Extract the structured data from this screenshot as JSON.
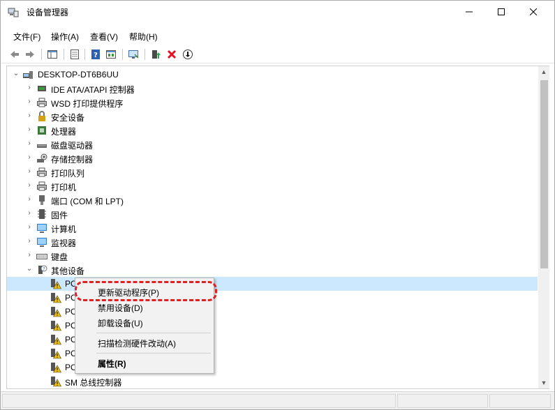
{
  "window": {
    "title": "设备管理器",
    "controls": {
      "minimize": "—",
      "maximize": "☐",
      "close": "✕"
    }
  },
  "menu": [
    {
      "label": "文件(F)"
    },
    {
      "label": "操作(A)"
    },
    {
      "label": "查看(V)"
    },
    {
      "label": "帮助(H)"
    }
  ],
  "toolbar": {
    "buttons": [
      "back-icon",
      "forward-icon",
      "show-hide-tree-icon",
      "properties-icon",
      "help-icon",
      "view-resources-icon",
      "monitor-icon",
      "update-driver-icon",
      "uninstall-icon",
      "scan-hardware-icon"
    ],
    "uninstall_color": "#e81123"
  },
  "tree": {
    "root": "DESKTOP-DT6B6UU",
    "categories": [
      {
        "label": "IDE ATA/ATAPI 控制器",
        "icon": "ide-controller-icon"
      },
      {
        "label": "WSD 打印提供程序",
        "icon": "printer-icon"
      },
      {
        "label": "安全设备",
        "icon": "security-device-icon"
      },
      {
        "label": "处理器",
        "icon": "processor-icon"
      },
      {
        "label": "磁盘驱动器",
        "icon": "disk-drive-icon"
      },
      {
        "label": "存储控制器",
        "icon": "storage-controller-icon"
      },
      {
        "label": "打印队列",
        "icon": "print-queue-icon"
      },
      {
        "label": "打印机",
        "icon": "printer-icon"
      },
      {
        "label": "端口 (COM 和 LPT)",
        "icon": "port-icon"
      },
      {
        "label": "固件",
        "icon": "firmware-icon"
      },
      {
        "label": "计算机",
        "icon": "computer-icon"
      },
      {
        "label": "监视器",
        "icon": "monitor-icon"
      },
      {
        "label": "键盘",
        "icon": "keyboard-icon"
      },
      {
        "label": "其他设备",
        "icon": "unknown-device-icon",
        "expanded": true
      }
    ],
    "other_devices": [
      {
        "label": "PCI"
      },
      {
        "label": "PC"
      },
      {
        "label": "PC"
      },
      {
        "label": "PC"
      },
      {
        "label": "PC"
      },
      {
        "label": "PC"
      },
      {
        "label": "PC"
      },
      {
        "label": "SM 总线控制器"
      }
    ]
  },
  "context_menu": {
    "items": [
      {
        "label": "更新驱动程序(P)",
        "bold": false
      },
      {
        "label": "禁用设备(D)",
        "bold": false
      },
      {
        "label": "卸载设备(U)",
        "bold": false
      },
      {
        "label": "扫描检测硬件改动(A)",
        "bold": false
      },
      {
        "label": "属性(R)",
        "bold": true
      }
    ],
    "highlight_color": "#e02020"
  }
}
